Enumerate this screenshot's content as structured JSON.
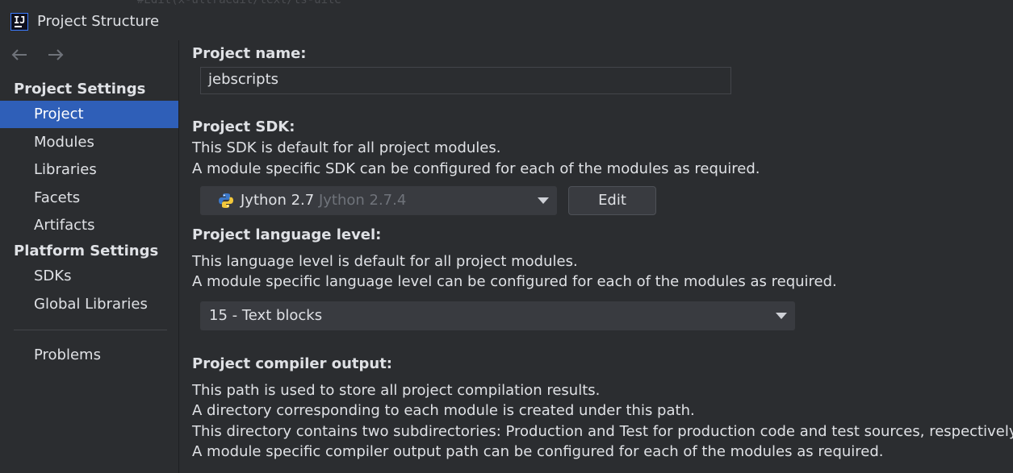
{
  "window": {
    "title": "Project Structure",
    "overlay_text": "#Edit(x-ultraedit/text/ts-uite"
  },
  "sidebar": {
    "groups": [
      "Project Settings",
      "Platform Settings"
    ],
    "items": [
      {
        "label": "Project",
        "selected": true
      },
      {
        "label": "Modules"
      },
      {
        "label": "Libraries"
      },
      {
        "label": "Facets"
      },
      {
        "label": "Artifacts"
      },
      {
        "label": "SDKs"
      },
      {
        "label": "Global Libraries"
      },
      {
        "label": "Problems"
      }
    ]
  },
  "project_name": {
    "label": "Project name:",
    "value": "jebscripts"
  },
  "project_sdk": {
    "label": "Project SDK:",
    "desc1": "This SDK is default for all project modules.",
    "desc2": "A module specific SDK can be configured for each of the modules as required.",
    "selected": "Jython 2.7",
    "version": "Jython 2.7.4",
    "edit_label": "Edit"
  },
  "language_level": {
    "label": "Project language level:",
    "desc1": "This language level is default for all project modules.",
    "desc2": "A module specific language level can be configured for each of the modules as required.",
    "selected": "15 - Text blocks"
  },
  "compiler_output": {
    "label": "Project compiler output:",
    "desc1": "This path is used to store all project compilation results.",
    "desc2": "A directory corresponding to each module is created under this path.",
    "desc3": "This directory contains two subdirectories: Production and Test for production code and test sources, respectively.",
    "desc4": "A module specific compiler output path can be configured for each of the modules as required."
  },
  "colors": {
    "background": "#2b2d30",
    "selection": "#2f5fb8",
    "text": "#dfe1e5",
    "muted": "#6f737a"
  }
}
